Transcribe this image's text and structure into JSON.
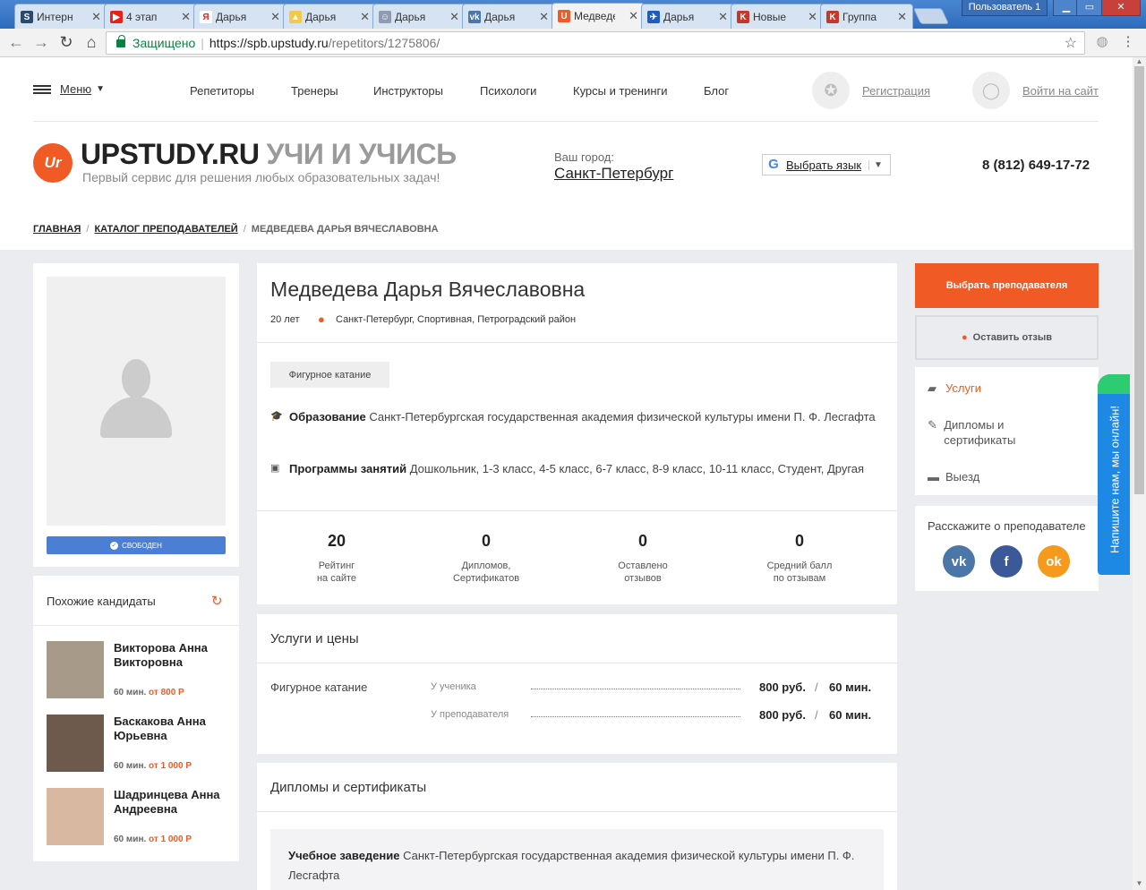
{
  "browser": {
    "tabs": [
      {
        "title": "Интерн",
        "icon": "site-icon",
        "color": "#2b4a6f",
        "glyph": "S"
      },
      {
        "title": "4 этап",
        "icon": "youtube-icon",
        "color": "#e62117",
        "glyph": "▶"
      },
      {
        "title": "Дарья",
        "icon": "yandex-icon",
        "color": "#ffffff",
        "glyph": "Я"
      },
      {
        "title": "Дарья",
        "icon": "image-icon",
        "color": "#f2c94c",
        "glyph": "▲"
      },
      {
        "title": "Дарья",
        "icon": "people-icon",
        "color": "#8e9bb3",
        "glyph": "☺"
      },
      {
        "title": "Дарья",
        "icon": "vk-icon",
        "color": "#4a76a8",
        "glyph": "vk"
      },
      {
        "title": "Медведе",
        "icon": "upstudy-icon",
        "color": "#f05a24",
        "glyph": "U"
      },
      {
        "title": "Дарья",
        "icon": "plane-icon",
        "color": "#1d5bbf",
        "glyph": "✈"
      },
      {
        "title": "Новые",
        "icon": "figure-skate-icon",
        "color": "#c0392b",
        "glyph": "K"
      },
      {
        "title": "Группа",
        "icon": "figure-skate-icon",
        "color": "#c0392b",
        "glyph": "K"
      }
    ],
    "user_label": "Пользователь 1",
    "secure_label": "Защищено",
    "url_host": "https://spb.upstudy.ru",
    "url_path": "/repetitors/1275806/"
  },
  "header": {
    "menu_label": "Меню",
    "nav": [
      "Репетиторы",
      "Тренеры",
      "Инструкторы",
      "Психологи",
      "Курсы и тренинги",
      "Блог"
    ],
    "register_label": "Регистрация",
    "login_label": "Войти на сайт",
    "logo_mark": "Ur",
    "logo_name": "UPSTUDY.RU",
    "logo_slogan": "УЧИ И УЧИСЬ",
    "logo_sub": "Первый сервис для решения любых образовательных задач!",
    "city_label": "Ваш город:",
    "city_value": "Санкт-Петербург",
    "lang_label": "Выбрать язык",
    "phone": "8 (812) 649-17-72"
  },
  "breadcrumbs": {
    "home": "ГЛАВНАЯ",
    "catalog": "КАТАЛОГ ПРЕПОДАВАТЕЛЕЙ",
    "current": "МЕДВЕДЕВА ДАРЬЯ ВЯЧЕСЛАВОВНА",
    "sep": "/"
  },
  "profile": {
    "status_badge": "СВОБОДЕН",
    "name": "Медведева Дарья Вячеславовна",
    "age": "20 лет",
    "location": "Санкт-Петербург, Спортивная, Петроградский район",
    "tag": "Фигурное катание",
    "education_label": "Образование",
    "education_text": "Санкт-Петербургская государственная академия физической культуры имени П. Ф. Лесгафта",
    "programs_label": "Программы занятий",
    "programs_text": "Дошкольник, 1-3 класс, 4-5 класс, 6-7 класс, 8-9 класс, 10-11 класс, Студент, Другая",
    "stats": [
      {
        "value": "20",
        "line1": "Рейтинг",
        "line2": "на сайте"
      },
      {
        "value": "0",
        "line1": "Дипломов,",
        "line2": "Сертификатов"
      },
      {
        "value": "0",
        "line1": "Оставлено",
        "line2": "отзывов"
      },
      {
        "value": "0",
        "line1": "Средний балл",
        "line2": "по отзывам"
      }
    ]
  },
  "similar": {
    "title": "Похожие кандидаты",
    "items": [
      {
        "name": "Викторова Анна Викторовна",
        "duration": "60 мин.",
        "from": "от 800 Р"
      },
      {
        "name": "Баскакова Анна Юрьевна",
        "duration": "60 мин.",
        "from": "от 1 000 Р"
      },
      {
        "name": "Шадринцева Анна Андреевна",
        "duration": "60 мин.",
        "from": "от 1 000 Р"
      }
    ]
  },
  "services": {
    "title": "Услуги и цены",
    "name": "Фигурное катание",
    "rows": [
      {
        "where": "У ученика",
        "price": "800 руб.",
        "slash": "/",
        "duration": "60 мин."
      },
      {
        "where": "У преподавателя",
        "price": "800 руб.",
        "slash": "/",
        "duration": "60 мин."
      }
    ]
  },
  "diplomas": {
    "title": "Дипломы и сертификаты",
    "edu_label": "Учебное заведение",
    "edu_text": "Санкт-Петербургская государственная академия физической культуры имени П. Ф. Лесгафта"
  },
  "sidebar": {
    "choose_button": "Выбрать преподавателя",
    "review_button": "Оставить отзыв",
    "links": [
      "Услуги",
      "Дипломы и сертификаты",
      "Выезд"
    ],
    "tell_label": "Расскажите о преподавателе",
    "social": [
      {
        "icon": "vk-icon",
        "glyph": "vk",
        "color": "#4a76a8"
      },
      {
        "icon": "facebook-icon",
        "glyph": "f",
        "color": "#3b5998"
      },
      {
        "icon": "odnoklassniki-icon",
        "glyph": "ok",
        "color": "#f59a1c"
      }
    ]
  },
  "chat": {
    "label": "Напишите нам, мы онлайн!"
  }
}
